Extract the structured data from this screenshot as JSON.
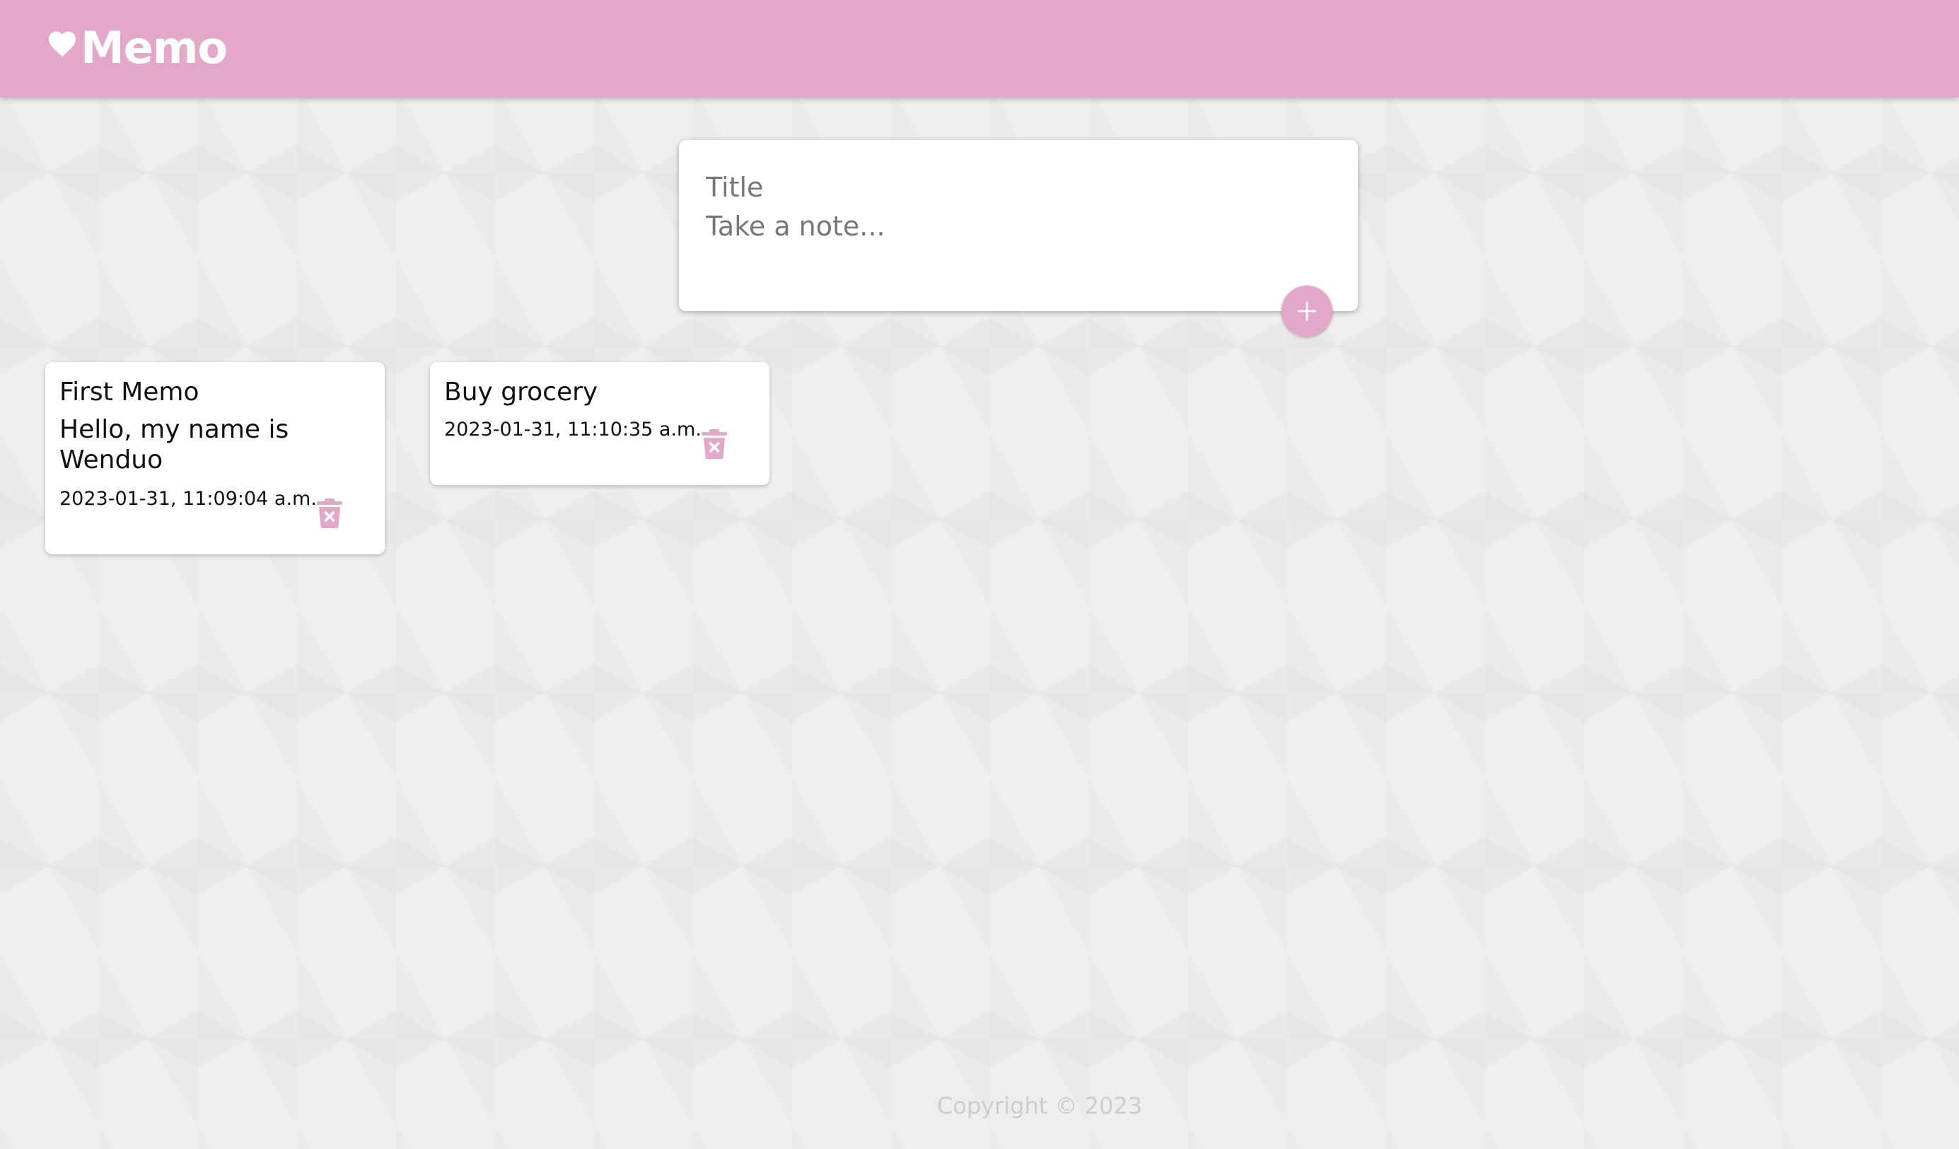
{
  "header": {
    "brand_text": "Memo",
    "icon": "heart-icon"
  },
  "create_form": {
    "title_placeholder": "Title",
    "content_placeholder": "Take a note...",
    "add_button_icon": "plus-icon"
  },
  "notes": [
    {
      "title": "First Memo",
      "content": "Hello, my name is Wenduo",
      "date": "2023-01-31, 11:09:04 a.m.",
      "delete_icon": "trash-x-icon"
    },
    {
      "title": "Buy grocery",
      "content": "",
      "date": "2023-01-31, 11:10:35 a.m.",
      "delete_icon": "trash-x-icon"
    }
  ],
  "footer": {
    "copyright": "Copyright © 2023"
  },
  "colors": {
    "accent": "#e3a8c8",
    "background": "#eeeeee",
    "card": "#ffffff"
  }
}
